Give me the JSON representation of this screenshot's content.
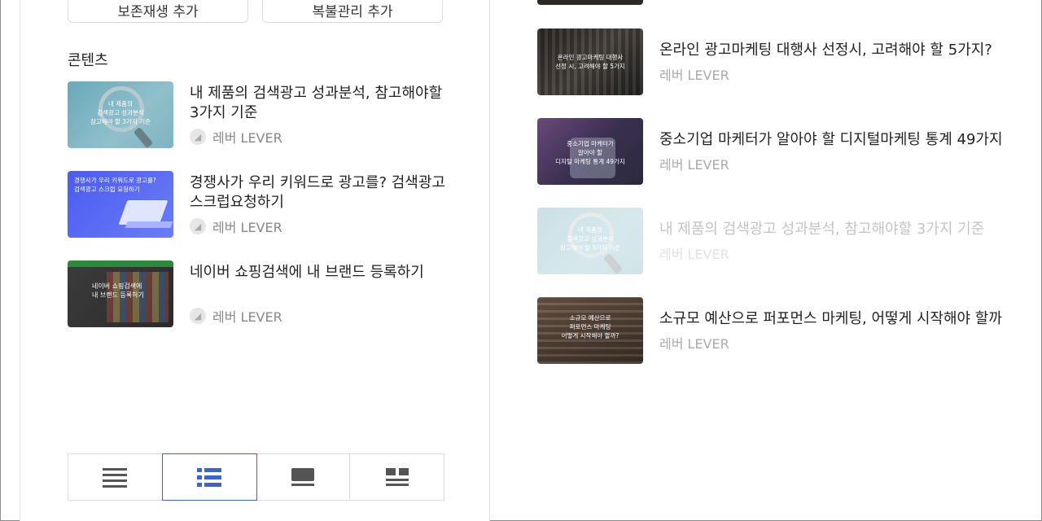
{
  "top_buttons": [
    {
      "label": "보존재생 추가"
    },
    {
      "label": "복불관리 추가"
    }
  ],
  "section": {
    "title": "콘텐츠"
  },
  "left_list": [
    {
      "title": "내 제품의 검색광고 성과분석, 참고해야할 3가지 기준",
      "author": "레버 LEVER",
      "thumb_text": "내 제품의\n검색광고 성과분석\n참고해야 할 3가지 기준"
    },
    {
      "title": "경쟁사가 우리 키워드로 광고를? 검색광고 스크럽요청하기",
      "author": "레버 LEVER",
      "thumb_text": "경쟁사가 우리 키워드로 광고를?\n검색광고 스크럽 요청하기"
    },
    {
      "title": "네이버 쇼핑검색에 내 브랜드 등록하기",
      "author": "레버 LEVER",
      "thumb_text": "네이버 쇼핑검색에\n내 브랜드 등록하기"
    }
  ],
  "right_list": [
    {
      "title": "온라인 광고마케팅 대행사 선정시, 고려해야 할 5가지?",
      "author": "레버 LEVER",
      "thumb_text": "온라인 광고마케팅 대행사\n선정 시, 고려해야 할 5가지"
    },
    {
      "title": "중소기업 마케터가 알아야 할 디지털마케팅 통계 49가지",
      "author": "레버 LEVER",
      "thumb_text": "중소기업 마케터가\n알아야 할\n디지털 마케팅 통계 49가지"
    },
    {
      "title": "내 제품의 검색광고 성과분석, 참고해야할 3가지 기준",
      "author": "레버 LEVER",
      "thumb_text": "내 제품의\n검색광고 성과분석\n참고해야 할 3가지 기준"
    },
    {
      "title": "소규모 예산으로 퍼포먼스 마케팅, 어떻게 시작해야 할까",
      "author": "레버 LEVER",
      "thumb_text": "소규모 예산으로\n퍼포먼스 마케팅\n어떻게 시작해야 할까?"
    }
  ],
  "view_toggle": {
    "options": [
      "list-icon",
      "list-thumb-icon",
      "card-icon",
      "gallery-icon"
    ],
    "active_index": 1,
    "active_color": "#3b63d4"
  }
}
